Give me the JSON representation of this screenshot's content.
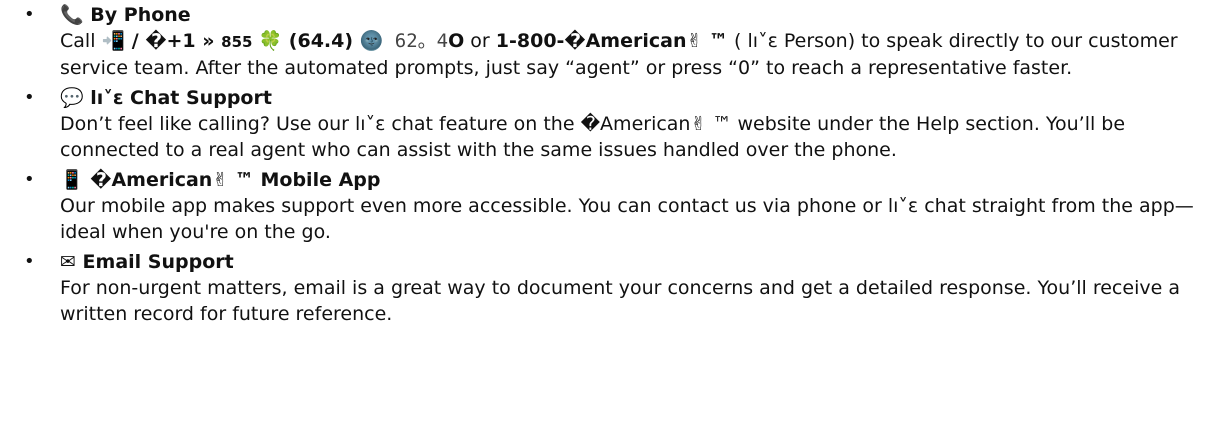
{
  "items": [
    {
      "bullet": "•",
      "icon": "📞",
      "title": "By Phone",
      "body": {
        "t1": "Call ",
        "icon_phone": "📲",
        "t2": " / �+1 » ",
        "t3": "855",
        "icon_clover": "🍀",
        "t4": " (64.4) ",
        "icon_moon": "🌚",
        "t5": " 62。4",
        "t6": "O",
        "t7": " or ",
        "t8": "1-800-�American",
        "icon_victory": "✌",
        "t9": " ™",
        "t10": " ( lı˅ɛ Person) to speak directly to our customer service team. After the automated prompts, just say “agent” or press “0” to reach a representative faster."
      }
    },
    {
      "bullet": "•",
      "icon": "💬",
      "title": "lı˅ɛ Chat Support",
      "body": {
        "t1": "Don’t feel like calling? Use our  lı˅ɛ chat feature on the �American",
        "icon_victory": "✌",
        "t2": " ™ website under the Help section. You’ll be connected to a real agent who can assist with the same issues handled over the phone."
      }
    },
    {
      "bullet": "•",
      "icon": "📱",
      "title_1": "�American",
      "title_icon": "✌",
      "title_2": " ™ Mobile App",
      "body": "Our mobile app makes support even more accessible. You can contact us via phone or  lı˅ɛ chat straight from the app—ideal when you're on the go."
    },
    {
      "bullet": "•",
      "icon": "✉",
      "title": "Email Support",
      "body": "For non-urgent matters, email is a great way to document your concerns and get a detailed response. You’ll receive a written record for future reference."
    }
  ]
}
